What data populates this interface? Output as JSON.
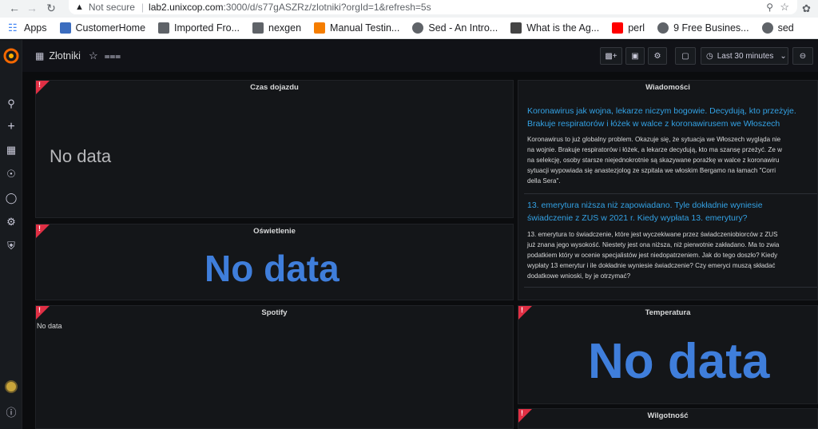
{
  "browser": {
    "security_label": "Not secure",
    "url_host": "lab2.unixcop.com",
    "url_path": ":3000/d/s77gASZRz/zlotniki?orgId=1&refresh=5s"
  },
  "bookmarks": [
    {
      "label": "Apps",
      "icon": "apps-grid-icon",
      "color": "#4285f4"
    },
    {
      "label": "CustomerHome",
      "icon": "customer-home-icon",
      "color": "#3b6dbf"
    },
    {
      "label": "Imported Fro...",
      "icon": "folder-icon",
      "color": "#5f6368"
    },
    {
      "label": "nexgen",
      "icon": "folder-icon",
      "color": "#5f6368"
    },
    {
      "label": "Manual Testin...",
      "icon": "blogger-icon",
      "color": "#f57d00"
    },
    {
      "label": "Sed - An Intro...",
      "icon": "globe-icon",
      "color": "#5f6368"
    },
    {
      "label": "What is the Ag...",
      "icon": "d-logo-icon",
      "color": "#444444"
    },
    {
      "label": "perl",
      "icon": "youtube-icon",
      "color": "#ff0000"
    },
    {
      "label": "9 Free Busines...",
      "icon": "globe-icon",
      "color": "#5f6368"
    },
    {
      "label": "sed",
      "icon": "globe-icon",
      "color": "#5f6368"
    }
  ],
  "dashboard": {
    "title": "Złotniki",
    "time_range": "Last 30 minutes"
  },
  "panels": {
    "czas": {
      "title": "Czas dojazdu",
      "nodata": "No data"
    },
    "oswietlenie": {
      "title": "Oświetlenie",
      "nodata": "No data"
    },
    "spotify": {
      "title": "Spotify",
      "nodata": "No data"
    },
    "temperatura": {
      "title": "Temperatura",
      "nodata": "No data"
    },
    "wilgotnosc": {
      "title": "Wilgotność"
    },
    "wiadomosci": {
      "title": "Wiadomości"
    }
  },
  "news": [
    {
      "headline": [
        "Koronawirus jak wojna, lekarze niczym bogowie. Decydują, kto przeżyje.",
        "Brakuje respiratorów i łóżek w walce z koronawirusem we Włoszech"
      ],
      "body": [
        "Koronawirus to już globalny problem. Okazuje się, że sytuacja we Włoszech wygląda nie",
        "na wojnie. Brakuje respiratorów i łóżek, a lekarze decydują, kto ma szansę przeżyć. Ze w",
        "na selekcję, osoby starsze niejednokrotnie są skazywane porażkę w walce z koronawiru",
        "sytuacji wypowiada się anastezjolog ze szpitala we włoskim Bergamo na łamach \"Corri",
        "della Sera\"."
      ]
    },
    {
      "headline": [
        "13. emerytura niższa niż zapowiadano. Tyle dokładnie wyniesie",
        "świadczenie z ZUS w 2021 r. Kiedy wypłata 13. emerytury?"
      ],
      "body": [
        "13. emerytura to świadczenie, które jest wyczekiwane przez świadczeniobiorców z ZUS",
        "już znana jego wysokość. Niestety jest ona niższa, niż pierwotnie zakładano. Ma to zwia",
        "podatkiem który w ocenie specjalistów jest niedopatrzeniem. Jak do tego doszło? Kiedy",
        "wypłaty 13 emerytur i ile dokładnie wyniesie świadczenie? Czy emeryci muszą składać",
        "dodatkowe wnioski, by je otrzymać?"
      ]
    }
  ],
  "alert_mark": "!",
  "colors": {
    "accent": "#3f7edb",
    "link": "#33a2e5",
    "alert": "#e02f44",
    "panel_bg": "#141619"
  }
}
